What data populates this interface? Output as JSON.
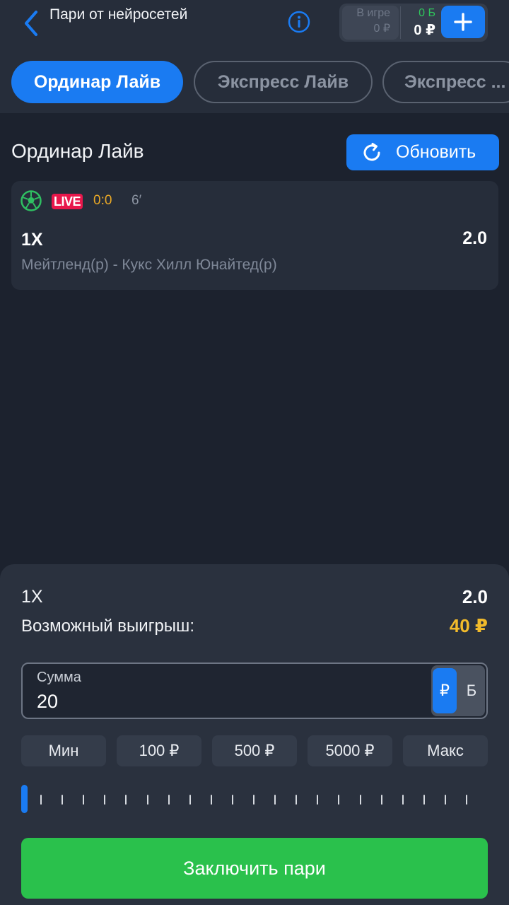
{
  "header": {
    "title": "Пари от нейросетей",
    "balance": {
      "in_play_label": "В игре",
      "in_play_value": "0 ₽",
      "bonus_value": "0 Б",
      "main_value": "0 ₽"
    }
  },
  "tabs": [
    {
      "label": "Ординар Лайв",
      "active": true
    },
    {
      "label": "Экспресс Лайв",
      "active": false
    },
    {
      "label": "Экспресс ...",
      "active": false
    }
  ],
  "section": {
    "title": "Ординар Лайв",
    "refresh_label": "Обновить"
  },
  "match": {
    "live_badge": "LIVE",
    "score": "0:0",
    "minute": "6′",
    "bet_type": "1X",
    "coefficient": "2.0",
    "teams": "Мейтленд(р) - Кукс Хилл Юнайтед(р)"
  },
  "bet_slip": {
    "bet_type": "1X",
    "coefficient": "2.0",
    "possible_win_label": "Возможный выигрыш:",
    "possible_win_value": "40 ₽",
    "amount_label": "Сумма",
    "amount_value": "20",
    "currency_rub": "₽",
    "currency_bonus": "Б",
    "quick_amounts": [
      "Мин",
      "100 ₽",
      "500 ₽",
      "5000 ₽",
      "Макс"
    ],
    "slider_level": 0,
    "submit_label": "Заключить пари"
  },
  "colors": {
    "accent": "#1a7bf2",
    "live": "#e8174b",
    "score": "#e9a826",
    "win": "#f2bb2b",
    "submit": "#2ac14c",
    "bonus": "#2fc65c"
  },
  "icons": {
    "back": "chevron-left-icon",
    "info": "info-icon",
    "add": "plus-icon",
    "refresh": "refresh-icon",
    "sport": "soccer-ball-icon"
  }
}
